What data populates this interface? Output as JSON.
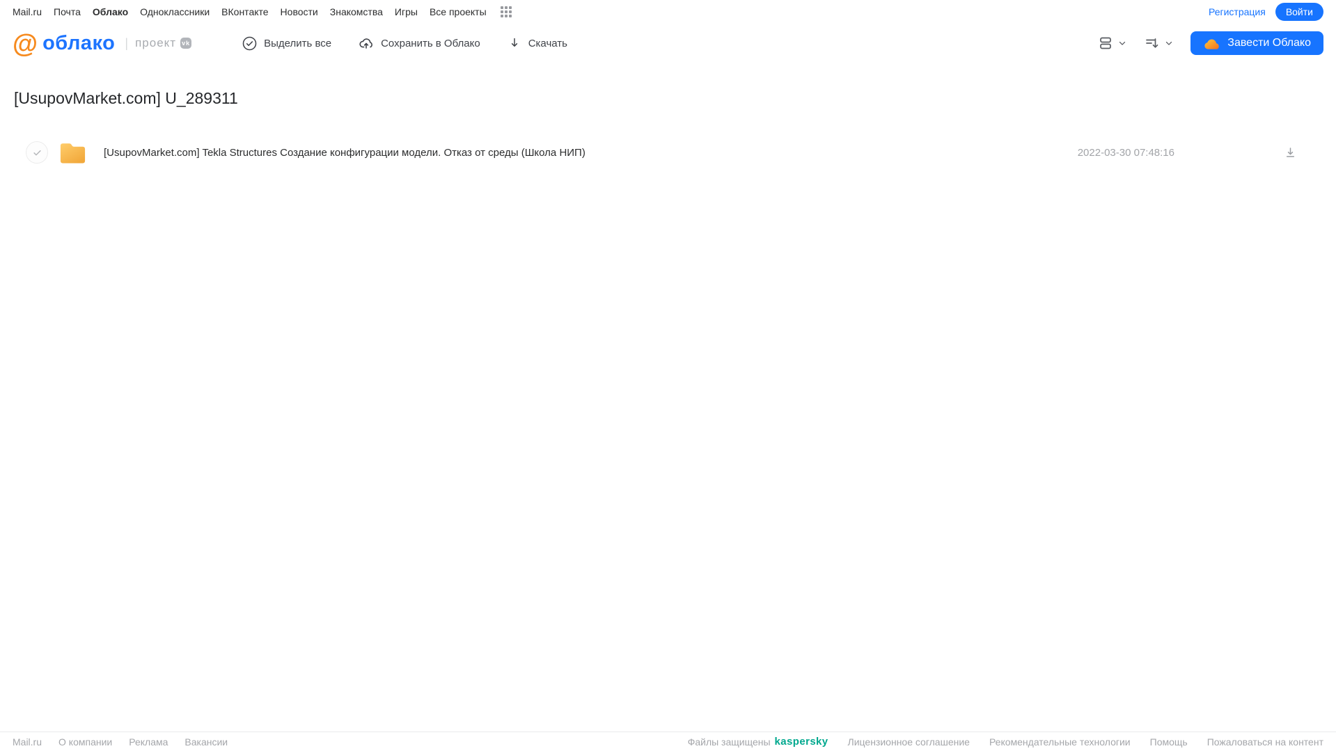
{
  "portal_nav": {
    "links": [
      "Mail.ru",
      "Почта",
      "Облако",
      "Одноклассники",
      "ВКонтакте",
      "Новости",
      "Знакомства",
      "Игры",
      "Все проекты"
    ],
    "active_link": "Облако",
    "registration_label": "Регистрация",
    "login_label": "Войти"
  },
  "header": {
    "logo_at": "@",
    "logo_text": "облако",
    "project_label": "проект",
    "vk_badge": "vk",
    "actions": [
      {
        "label": "Выделить все",
        "icon": "check-circle-icon"
      },
      {
        "label": "Сохранить в Облако",
        "icon": "cloud-upload-icon"
      },
      {
        "label": "Скачать",
        "icon": "download-icon"
      }
    ],
    "create_cloud_label": "Завести Облако"
  },
  "main": {
    "title": "[UsupovMarket.com] U_289311",
    "files": [
      {
        "type": "folder",
        "name": "[UsupovMarket.com] Tekla Structures Создание конфигурации модели. Отказ от среды (Школа НИП)",
        "modified": "2022-03-30 07:48:16"
      }
    ]
  },
  "footer": {
    "left_links": [
      "Mail.ru",
      "О компании",
      "Реклама",
      "Вакансии"
    ],
    "protected_text": "Файлы защищены",
    "kaspersky_label": "kaspersky",
    "right_links": [
      "Лицензионное соглашение",
      "Рекомендательные технологии",
      "Помощь",
      "Пожаловаться на контент"
    ]
  },
  "colors": {
    "accent_blue": "#1774ff",
    "logo_orange": "#f68a1e",
    "kaspersky_teal": "#00a88e",
    "folder_yellow": "#f5ab3d"
  }
}
